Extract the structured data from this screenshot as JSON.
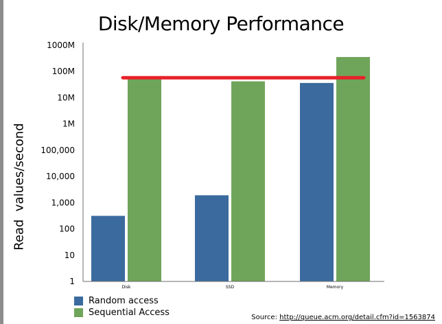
{
  "page": {
    "source_prefix": "Source: ",
    "source_link": "http://queue.acm.org/detail.cfm?id=1563874"
  },
  "chart_data": {
    "type": "bar",
    "title": "Disk/Memory Performance",
    "ylabel": "Read  values/second",
    "xlabel": "",
    "yscale": "log",
    "ylim": [
      1,
      1000000000
    ],
    "yticks": [
      1,
      10,
      100,
      1000,
      10000,
      100000,
      1000000,
      10000000,
      100000000,
      1000000000
    ],
    "ytick_labels": [
      "1",
      "10",
      "100",
      "1,000",
      "10,000",
      "100,000",
      "1M",
      "10M",
      "100M",
      "1000M"
    ],
    "categories": [
      "Disk",
      "SSD",
      "Memory"
    ],
    "series": [
      {
        "name": "Random access",
        "color": "#3b6a9e",
        "values": [
          316,
          1924,
          36700000
        ]
      },
      {
        "name": "Sequential Access",
        "color": "#6fa55a",
        "values": [
          52200000,
          42400000,
          358000000
        ]
      }
    ],
    "reference_line": {
      "value": 58000000,
      "color": "#e8212a"
    },
    "grid": false,
    "legend_position": "bottom-left"
  }
}
